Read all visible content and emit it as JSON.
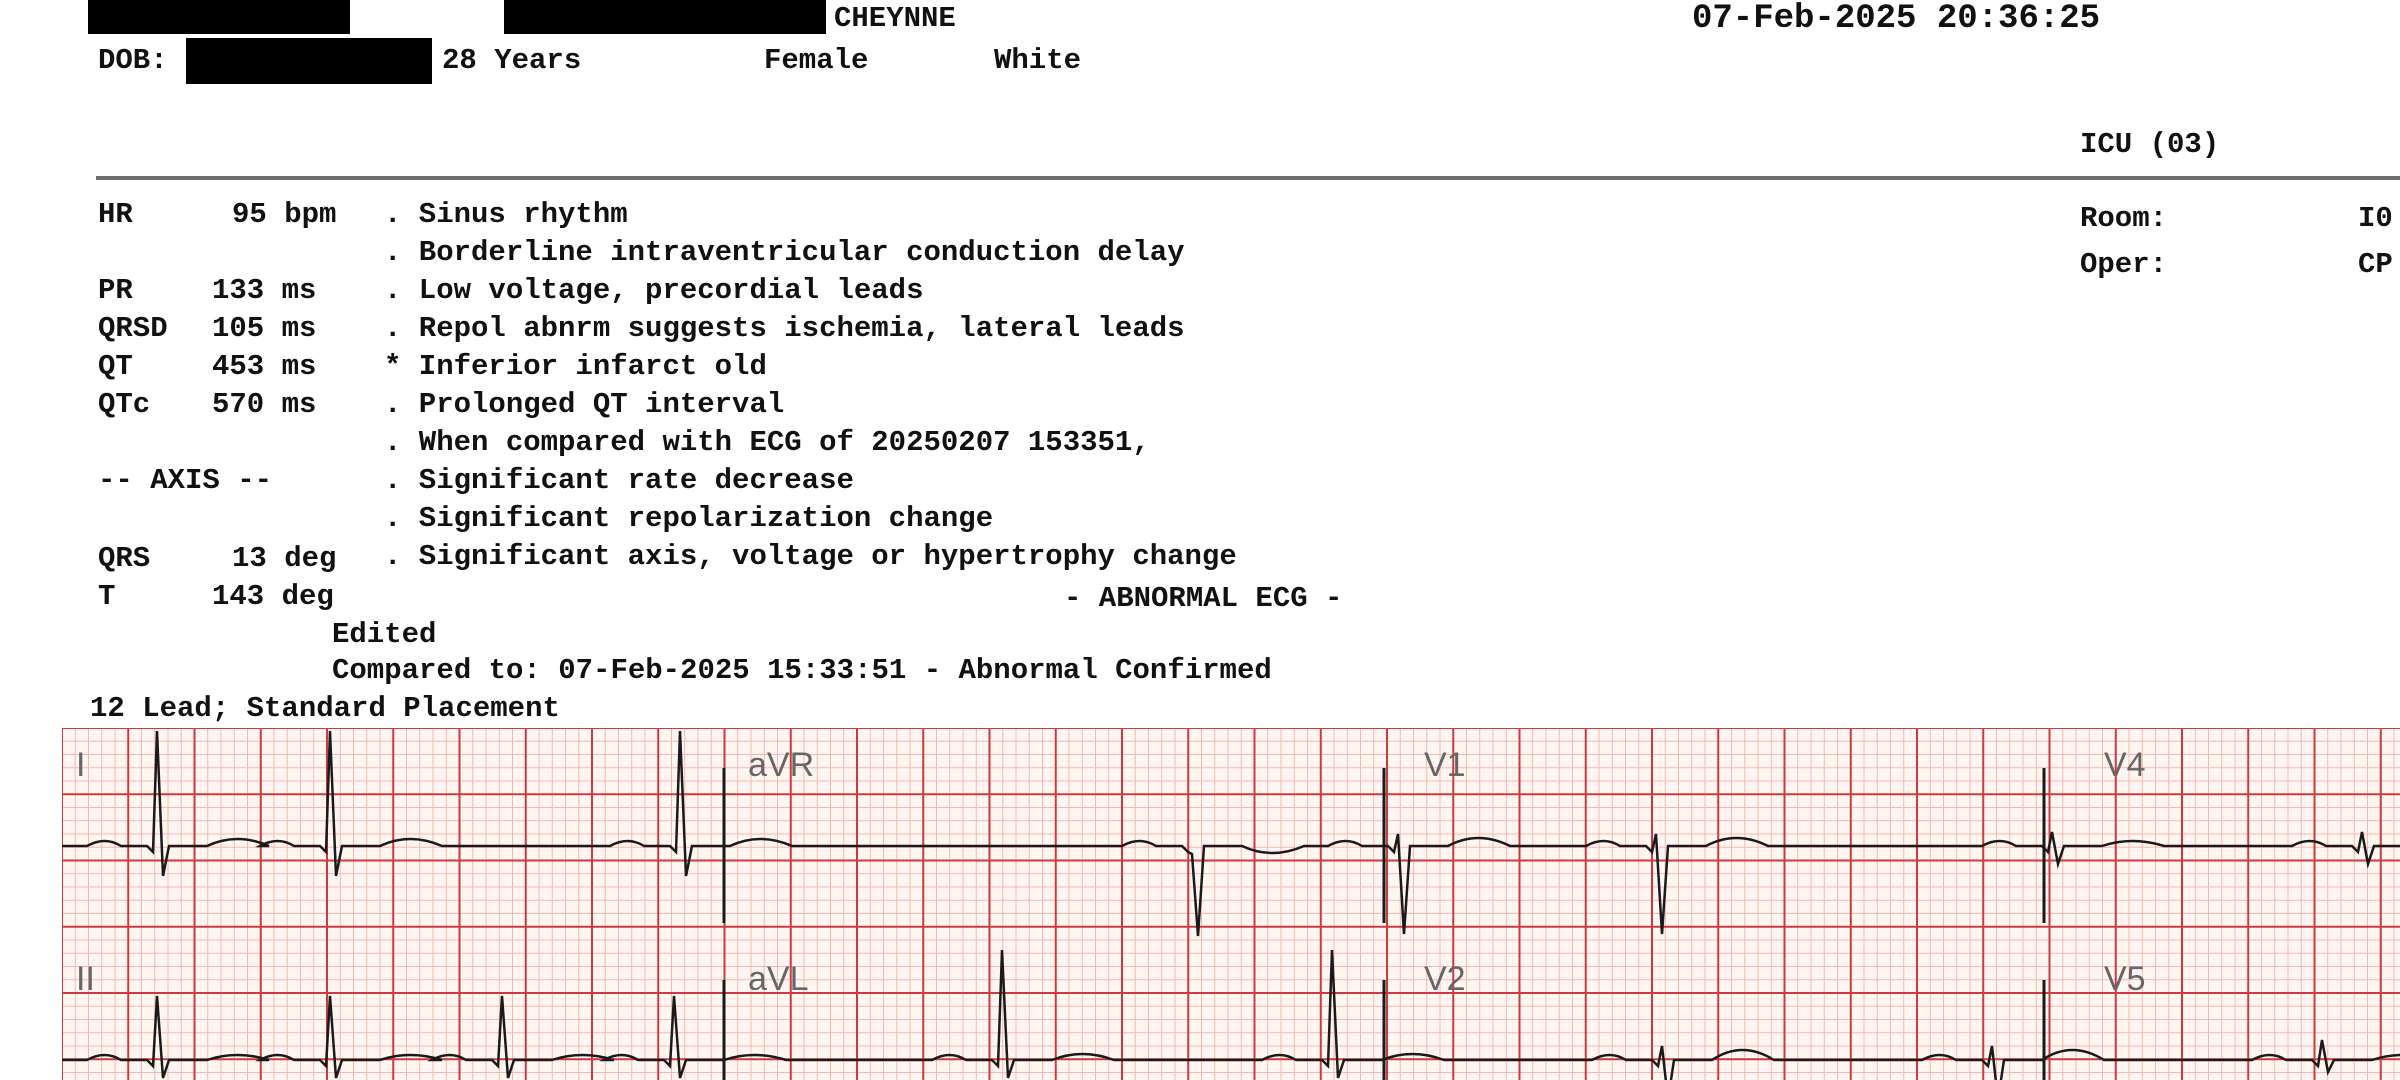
{
  "patient": {
    "name": "CHEYNNE",
    "dob_label": "DOB:",
    "age": "28 Years",
    "sex": "Female",
    "race": "White"
  },
  "datetime": "07-Feb-2025 20:36:25",
  "location": {
    "unit": "ICU (03)",
    "room_label": "Room:",
    "room_value": "I0",
    "oper_label": "Oper:",
    "oper_value": "CP"
  },
  "measurements": {
    "hr": {
      "label": "HR",
      "value": "95 bpm"
    },
    "pr": {
      "label": "PR",
      "value": "133 ms"
    },
    "qrsd": {
      "label": "QRSD",
      "value": "105 ms"
    },
    "qt": {
      "label": "QT",
      "value": "453 ms"
    },
    "qtc": {
      "label": "QTc",
      "value": "570 ms"
    },
    "axis_header": "-- AXIS --",
    "qrs": {
      "label": "QRS",
      "value": "13 deg"
    },
    "t": {
      "label": "T",
      "value": "143 deg"
    }
  },
  "interpretation": [
    ". Sinus rhythm",
    ". Borderline intraventricular conduction delay",
    ". Low voltage, precordial leads",
    ". Repol abnrm suggests ischemia, lateral leads",
    "* Inferior infarct old",
    ". Prolonged QT interval",
    ". When compared with ECG of 20250207 153351,",
    ". Significant rate decrease",
    ". Significant repolarization change",
    ". Significant axis, voltage or hypertrophy change"
  ],
  "verdict": "- ABNORMAL ECG -",
  "edited": "Edited",
  "compared_to": "Compared to: 07-Feb-2025 15:33:51 - Abnormal Confirmed",
  "placement": "12 Lead; Standard Placement",
  "leads": [
    "I",
    "aVR",
    "V1",
    "V4",
    "II",
    "aVL",
    "V2",
    "V5"
  ],
  "colors": {
    "grid_fine": "#f4b9b0",
    "grid_major": "#cc3a40",
    "grid_bg": "#fff6f2",
    "trace": "#1a1a1a"
  }
}
